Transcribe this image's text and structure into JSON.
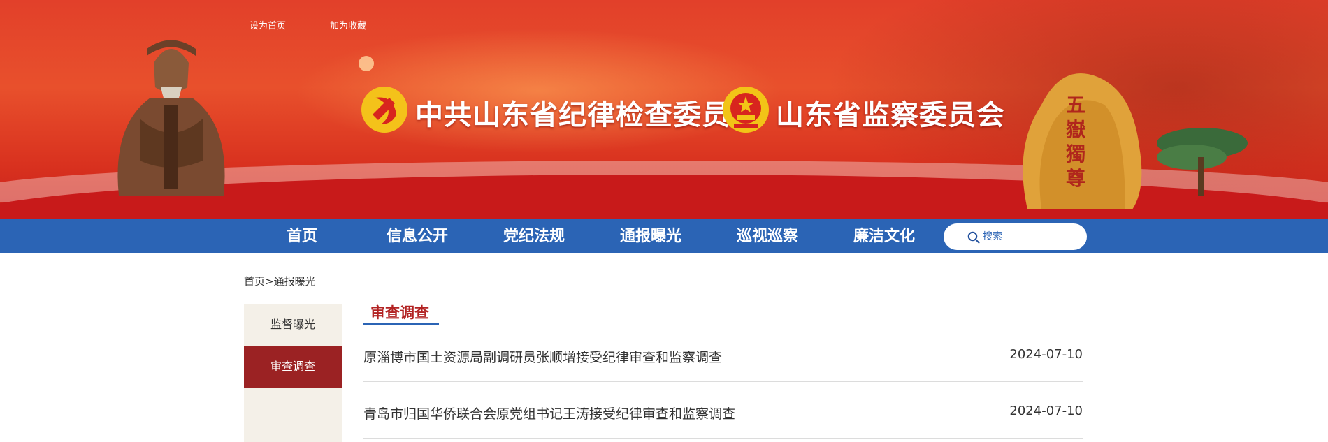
{
  "header": {
    "top_links": [
      "设为首页",
      "加为收藏"
    ],
    "org_party": "中共山东省纪律检查委员会",
    "org_supervision": "山东省监察委员会",
    "rock_inscription": "五嶽獨尊",
    "colors": {
      "banner": "#e2402a",
      "nav": "#2b64b5",
      "active": "#9b2223",
      "title": "#b22222"
    }
  },
  "nav": {
    "items": [
      "首页",
      "信息公开",
      "党纪法规",
      "通报曝光",
      "巡视巡察",
      "廉洁文化"
    ],
    "search_placeholder": "搜索"
  },
  "breadcrumb": {
    "home": "首页",
    "sep": ">",
    "current": "通报曝光"
  },
  "sidebar": {
    "items": [
      {
        "label": "监督曝光",
        "active": false
      },
      {
        "label": "审查调查",
        "active": true
      }
    ]
  },
  "main": {
    "section_title": "审查调查",
    "articles": [
      {
        "title": "原淄博市国土资源局副调研员张顺增接受纪律审查和监察调查",
        "date": "2024-07-10"
      },
      {
        "title": "青岛市归国华侨联合会原党组书记王涛接受纪律审查和监察调查",
        "date": "2024-07-10"
      }
    ]
  }
}
